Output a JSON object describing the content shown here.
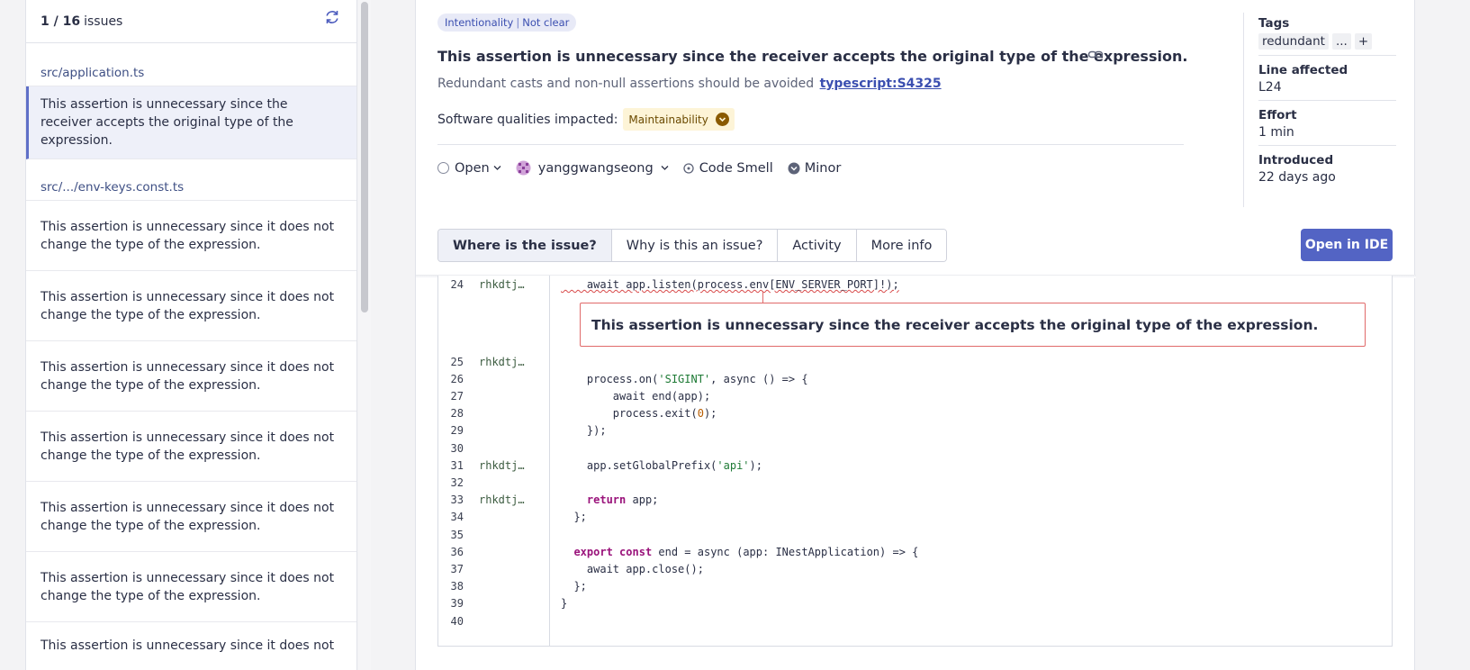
{
  "left": {
    "count": "1 / 16",
    "count_label": "issues",
    "files": [
      {
        "name": "src/application.ts"
      },
      {
        "name": "src/.../env-keys.const.ts"
      }
    ],
    "selected_issue": "This assertion is unnecessary since the receiver accepts the original type of the expression.",
    "other_issue": "This assertion is unnecessary since it does not change the type of the expression.",
    "last_issue_partial": "This assertion is unnecessary since it does not"
  },
  "issue": {
    "badge_category": "Intentionality",
    "badge_sep": "|",
    "badge_value": "Not clear",
    "title": "This assertion is unnecessary since the receiver accepts the original type of the expression.",
    "rule_text": "Redundant casts and non-null assertions should be avoided",
    "rule_link": "typescript:S4325",
    "qualities_label": "Software qualities impacted:",
    "quality": "Maintainability",
    "status": "Open",
    "assignee": "yanggwangseong",
    "type": "Code Smell",
    "severity": "Minor"
  },
  "tabs": [
    {
      "label": "Where is the issue?",
      "active": true
    },
    {
      "label": "Why is this an issue?",
      "active": false
    },
    {
      "label": "Activity",
      "active": false
    },
    {
      "label": "More info",
      "active": false
    }
  ],
  "open_ide": "Open in IDE",
  "side": {
    "tags_label": "Tags",
    "tags": [
      "redundant",
      "...",
      "+"
    ],
    "line_label": "Line affected",
    "line_value": "L24",
    "effort_label": "Effort",
    "effort_value": "1 min",
    "introduced_label": "Introduced",
    "introduced_value": "22 days ago"
  },
  "code": {
    "author_short": "rhkdtj…",
    "message": "This assertion is unnecessary since the receiver accepts the original type of the expression.",
    "line_numbers": [
      "24",
      "25",
      "26",
      "27",
      "28",
      "29",
      "30",
      "31",
      "32",
      "33",
      "34",
      "35",
      "36",
      "37",
      "38",
      "39",
      "40"
    ],
    "lines": {
      "l24": "    await app.listen(process.env[ENV_SERVER_PORT]!);",
      "l26_a": "    process.on(",
      "l26_s": "'SIGINT'",
      "l26_b": ", async () => {",
      "l27": "        await end(app);",
      "l28_a": "        process.exit(",
      "l28_n": "0",
      "l28_b": ");",
      "l29": "    });",
      "l31_a": "    app.setGlobalPrefix(",
      "l31_s": "'api'",
      "l31_b": ");",
      "l33_k": "return",
      "l33_b": " app;",
      "l34": "  };",
      "l36_k1": "export",
      "l36_k2": "const",
      "l36_b": " end = async (app: INestApplication) => {",
      "l37": "    await app.close();",
      "l38": "  };",
      "l39": "}"
    }
  }
}
